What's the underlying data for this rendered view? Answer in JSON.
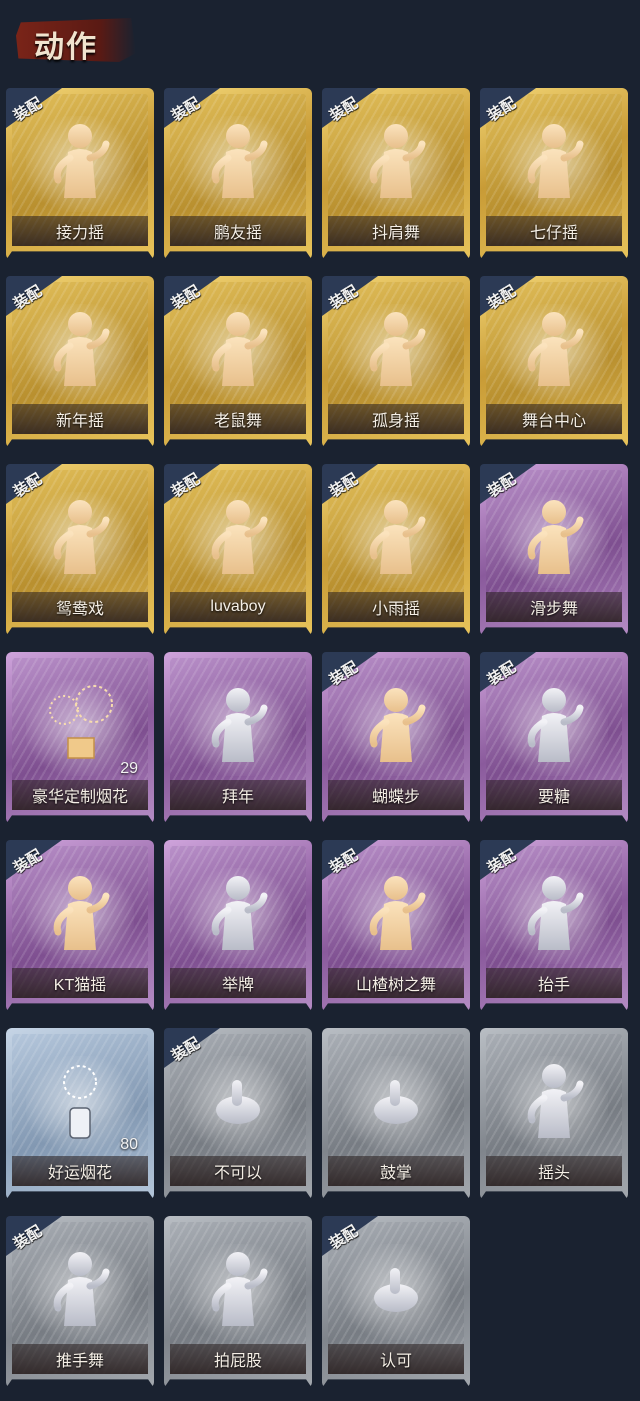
{
  "section_title": "动作",
  "equip_label": "装配",
  "colors": {
    "background": "#1a2230",
    "gold": "#d9b24a",
    "purple": "#9c6cb0",
    "blue": "#9fb3ca",
    "grey": "#8d9298",
    "badge": "#2c3a55"
  },
  "items": [
    {
      "name": "接力摇",
      "rarity": "gold",
      "equipped": true,
      "icon": "dancer-icon"
    },
    {
      "name": "鹏友摇",
      "rarity": "gold",
      "equipped": true,
      "icon": "dancer-icon"
    },
    {
      "name": "抖肩舞",
      "rarity": "gold",
      "equipped": true,
      "icon": "dancer-icon"
    },
    {
      "name": "七仔摇",
      "rarity": "gold",
      "equipped": true,
      "icon": "dancer-icon"
    },
    {
      "name": "新年摇",
      "rarity": "gold",
      "equipped": true,
      "icon": "dancer-icon"
    },
    {
      "name": "老鼠舞",
      "rarity": "gold",
      "equipped": true,
      "icon": "dancer-icon"
    },
    {
      "name": "孤身摇",
      "rarity": "gold",
      "equipped": true,
      "icon": "dancer-icon"
    },
    {
      "name": "舞台中心",
      "rarity": "gold",
      "equipped": true,
      "icon": "dancer-icon"
    },
    {
      "name": "鸳鸯戏",
      "rarity": "gold",
      "equipped": true,
      "icon": "dancer-icon"
    },
    {
      "name": "luvaboy",
      "rarity": "gold",
      "equipped": true,
      "icon": "dancer-icon"
    },
    {
      "name": "小雨摇",
      "rarity": "gold",
      "equipped": true,
      "icon": "dancer-icon"
    },
    {
      "name": "滑步舞",
      "rarity": "purple",
      "equipped": true,
      "icon": "dancer-icon"
    },
    {
      "name": "豪华定制烟花",
      "rarity": "purple",
      "equipped": false,
      "icon": "fireworks-box-icon",
      "count": "29"
    },
    {
      "name": "拜年",
      "rarity": "purple",
      "equipped": false,
      "icon": "bowing-figure-icon"
    },
    {
      "name": "蝴蝶步",
      "rarity": "purple",
      "equipped": true,
      "icon": "dancer-icon"
    },
    {
      "name": "要糖",
      "rarity": "purple",
      "equipped": true,
      "icon": "reaching-figure-icon"
    },
    {
      "name": "KT猫摇",
      "rarity": "purple",
      "equipped": true,
      "icon": "dancer-icon"
    },
    {
      "name": "举牌",
      "rarity": "purple",
      "equipped": false,
      "icon": "sign-holder-icon"
    },
    {
      "name": "山楂树之舞",
      "rarity": "purple",
      "equipped": true,
      "icon": "dancer-icon"
    },
    {
      "name": "抬手",
      "rarity": "purple",
      "equipped": true,
      "icon": "raising-hands-icon"
    },
    {
      "name": "好运烟花",
      "rarity": "blue",
      "equipped": false,
      "icon": "firework-can-icon",
      "count": "80"
    },
    {
      "name": "不可以",
      "rarity": "grey",
      "equipped": true,
      "icon": "finger-wag-icon"
    },
    {
      "name": "鼓掌",
      "rarity": "grey",
      "equipped": false,
      "icon": "clapping-hands-icon"
    },
    {
      "name": "摇头",
      "rarity": "grey",
      "equipped": false,
      "icon": "head-shake-icon"
    },
    {
      "name": "推手舞",
      "rarity": "grey",
      "equipped": true,
      "icon": "push-hands-icon"
    },
    {
      "name": "拍屁股",
      "rarity": "grey",
      "equipped": false,
      "icon": "walking-figure-icon"
    },
    {
      "name": "认可",
      "rarity": "grey",
      "equipped": true,
      "icon": "thumbs-up-icon"
    }
  ]
}
